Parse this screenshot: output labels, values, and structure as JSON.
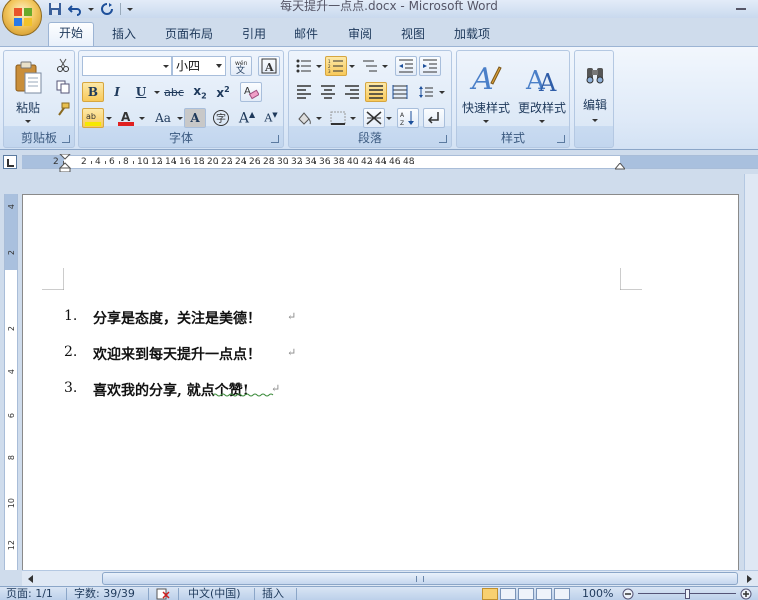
{
  "window": {
    "title": "每天提升一点点.docx - Microsoft Word"
  },
  "tabs": [
    {
      "label": "开始",
      "active": true
    },
    {
      "label": "插入"
    },
    {
      "label": "页面布局"
    },
    {
      "label": "引用"
    },
    {
      "label": "邮件"
    },
    {
      "label": "审阅"
    },
    {
      "label": "视图"
    },
    {
      "label": "加载项"
    }
  ],
  "ribbon": {
    "clipboard": {
      "label": "剪贴板",
      "paste": "粘贴"
    },
    "font": {
      "label": "字体",
      "font_name": "",
      "font_size": "小四"
    },
    "paragraph": {
      "label": "段落"
    },
    "styles": {
      "label": "样式",
      "quick_styles": "快速样式",
      "change_styles": "更改样式"
    },
    "editing": {
      "label": "编辑"
    }
  },
  "ruler": {
    "labels": [
      "2",
      "2",
      "4",
      "6",
      "8",
      "10",
      "12",
      "14",
      "16",
      "18",
      "20",
      "22",
      "24",
      "26",
      "28",
      "30",
      "32",
      "34",
      "36",
      "38",
      "40",
      "42",
      "44",
      "46",
      "48"
    ],
    "vlabels": [
      "4",
      "2",
      "2",
      "4",
      "6",
      "8",
      "10",
      "12"
    ]
  },
  "document": {
    "list": [
      {
        "num": "1.",
        "text": "分享是态度，关注是美德！"
      },
      {
        "num": "2.",
        "text": "欢迎来到每天提升一点点！"
      },
      {
        "num": "3.",
        "text": "喜欢我的分享, 就点个赞!"
      }
    ],
    "pilcrow": "↵"
  },
  "status": {
    "page": "页面: 1/1",
    "words": "字数: 39/39",
    "lang": "中文(中国)",
    "mode": "插入",
    "zoom": "100%"
  },
  "colors": {
    "accent": "#1e395b",
    "ribbon": "#dfeaf8"
  }
}
